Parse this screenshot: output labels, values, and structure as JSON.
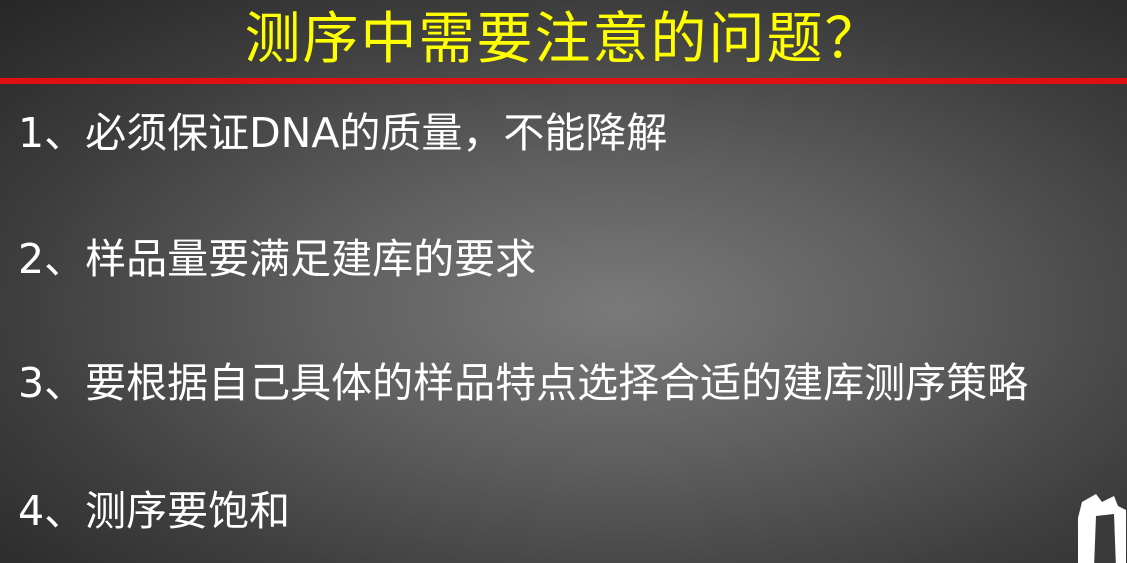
{
  "slide": {
    "title": "测序中需要注意的问题？",
    "items": [
      "1、必须保证DNA的质量，不能降解",
      "2、样品量要满足建库的要求",
      "3、要根据自己具体的样品特点选择合适的建库测序策略",
      "4、测序要饱和"
    ]
  },
  "colors": {
    "title": "#ffff00",
    "divider": "#e01010",
    "text": "#ffffff",
    "background": "#4a4a4a"
  }
}
